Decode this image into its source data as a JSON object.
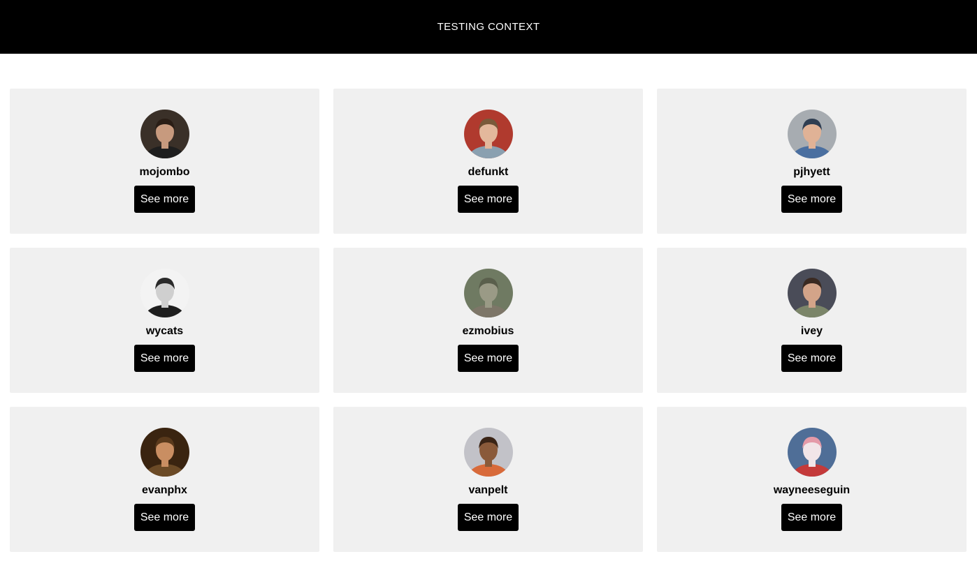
{
  "header": {
    "title": "TESTING CONTEXT"
  },
  "users": [
    {
      "login": "mojombo",
      "button_label": "See more",
      "avatar_colors": {
        "bg": "#3a3028",
        "face": "#c79a7e",
        "hair": "#2a1e16",
        "shirt": "#1e1e1e"
      }
    },
    {
      "login": "defunkt",
      "button_label": "See more",
      "avatar_colors": {
        "bg": "#b03a2e",
        "face": "#e3b89c",
        "hair": "#7a5a3a",
        "shirt": "#8aa0b0"
      }
    },
    {
      "login": "pjhyett",
      "button_label": "See more",
      "avatar_colors": {
        "bg": "#a7acb1",
        "face": "#e0b296",
        "hair": "#2f3e52",
        "shirt": "#4a6fa0"
      }
    },
    {
      "login": "wycats",
      "button_label": "See more",
      "avatar_colors": {
        "bg": "#f3f3f3",
        "face": "#cfcfcf",
        "hair": "#2a2a2a",
        "shirt": "#1e1e1e"
      }
    },
    {
      "login": "ezmobius",
      "button_label": "See more",
      "avatar_colors": {
        "bg": "#6f7a62",
        "face": "#9a9a86",
        "hair": "#5a5f4c",
        "shirt": "#7d7668"
      }
    },
    {
      "login": "ivey",
      "button_label": "See more",
      "avatar_colors": {
        "bg": "#4a4c58",
        "face": "#d3a489",
        "hair": "#3a2a22",
        "shirt": "#7b8569"
      }
    },
    {
      "login": "evanphx",
      "button_label": "See more",
      "avatar_colors": {
        "bg": "#3a2410",
        "face": "#c98e62",
        "hair": "#5a3a1c",
        "shirt": "#6b4a26"
      }
    },
    {
      "login": "vanpelt",
      "button_label": "See more",
      "avatar_colors": {
        "bg": "#c2c2c8",
        "face": "#8a5a3a",
        "hair": "#3a2416",
        "shirt": "#d86a3a"
      }
    },
    {
      "login": "wayneeseguin",
      "button_label": "See more",
      "avatar_colors": {
        "bg": "#4f6e97",
        "face": "#f1e5e8",
        "hair": "#e49aa8",
        "shirt": "#c43a3a"
      }
    }
  ]
}
